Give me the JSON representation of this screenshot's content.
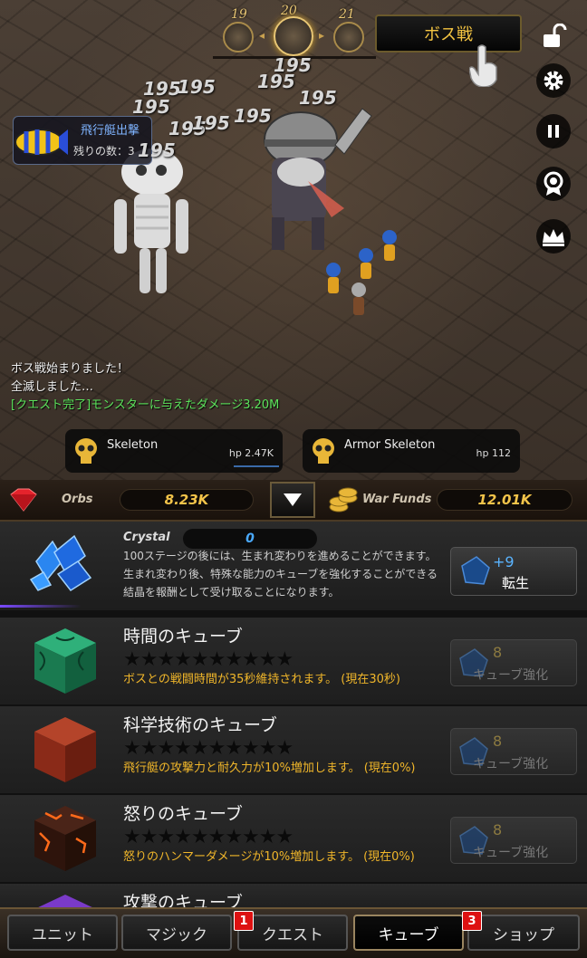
{
  "stage": {
    "prev": "19",
    "current": "20",
    "next": "21"
  },
  "boss_button": "ボス戦",
  "airship": {
    "title": "飛行艇出撃",
    "remaining": "残りの数：3"
  },
  "damage_numbers": [
    "195",
    "195",
    "195",
    "195",
    "195",
    "195",
    "195",
    "195",
    "195",
    "195"
  ],
  "log": [
    "ボス戦始まりました！",
    "全滅しました…",
    "[クエスト完了]モンスターに与えたダメージ3.20M"
  ],
  "monsters": [
    {
      "name": "Skeleton",
      "hp": "hp 2.47K"
    },
    {
      "name": "Armor Skeleton",
      "hp": "hp 112"
    }
  ],
  "resources": {
    "orbs_label": "Orbs",
    "orbs_value": "8.23K",
    "funds_label": "War Funds",
    "funds_value": "12.01K"
  },
  "crystal": {
    "label": "Crystal",
    "value": "0",
    "description": "100ステージの後には、生まれ変わりを進めることができます。生まれ変わり後、特殊な能力のキューブを強化することができる結晶を報酬として受け取ることになります。",
    "rebirth_bonus": "+9",
    "rebirth_label": "転生"
  },
  "cubes": [
    {
      "title": "時間のキューブ",
      "desc": "ボスとの戦闘時間が35秒維持されます。 (現在30秒)",
      "cost": "8",
      "button": "キューブ強化",
      "stars": "★★★★★★★★★★"
    },
    {
      "title": "科学技術のキューブ",
      "desc": "飛行艇の攻撃力と耐久力が10%増加します。 (現在0%)",
      "cost": "8",
      "button": "キューブ強化",
      "stars": "★★★★★★★★★★"
    },
    {
      "title": "怒りのキューブ",
      "desc": "怒りのハンマーダメージが10%増加します。 (現在0%)",
      "cost": "8",
      "button": "キューブ強化",
      "stars": "★★★★★★★★★★"
    },
    {
      "title": "攻撃のキューブ"
    }
  ],
  "tabs": [
    {
      "label": "ユニット"
    },
    {
      "label": "マジック"
    },
    {
      "label": "クエスト",
      "badge": "1"
    },
    {
      "label": "キューブ"
    },
    {
      "label": "ショップ",
      "badge": "3"
    }
  ],
  "colors": {
    "gold": "#f3c44a",
    "blue": "#4aaaff",
    "orange_desc": "#f0b62a",
    "badge_red": "#dd1111"
  }
}
